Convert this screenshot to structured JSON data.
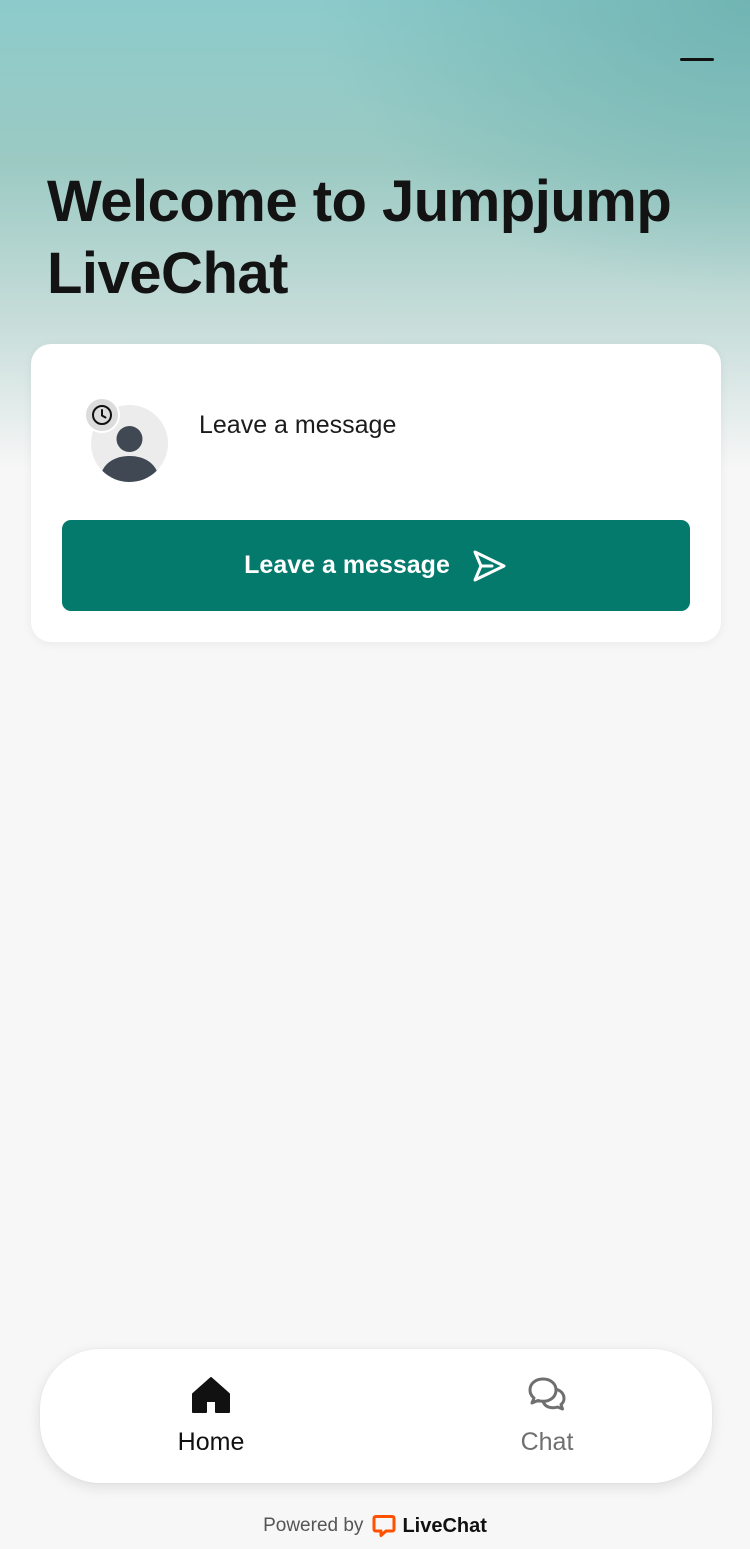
{
  "header": {
    "title": "Welcome to Jumpjump LiveChat",
    "minimize_icon": "minimize-icon"
  },
  "card": {
    "label": "Leave a message",
    "avatar_icon": "person-avatar-icon",
    "badge_icon": "clock-icon",
    "button_label": "Leave a message",
    "button_icon": "send-icon",
    "button_color": "#037a6c"
  },
  "tabs": [
    {
      "label": "Home",
      "icon": "home-icon",
      "active": true
    },
    {
      "label": "Chat",
      "icon": "chat-bubbles-icon",
      "active": false
    }
  ],
  "footer": {
    "powered_label": "Powered by",
    "brand": "LiveChat",
    "brand_color": "#ff5100"
  },
  "colors": {
    "gradient_top": "#8ccbcb",
    "page_background": "#f7f7f7"
  }
}
